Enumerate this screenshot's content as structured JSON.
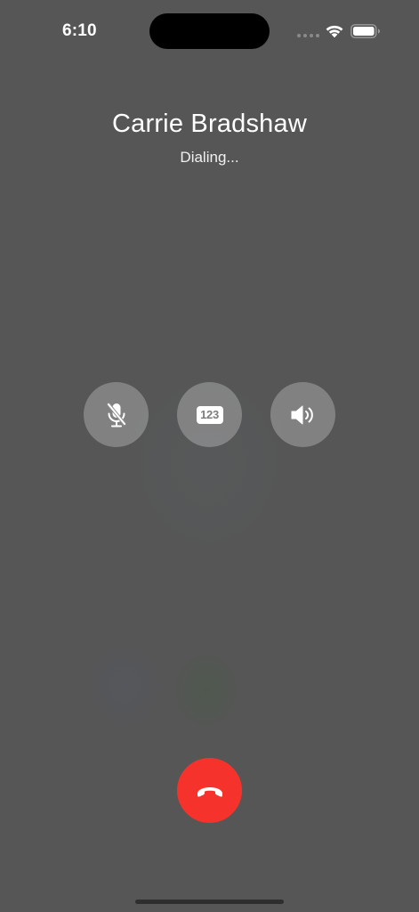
{
  "status_bar": {
    "time": "6:10",
    "icons": [
      "cellular-signal-icon",
      "wifi-icon",
      "battery-icon"
    ]
  },
  "call": {
    "caller_name": "Carrie Bradshaw",
    "status": "Dialing..."
  },
  "controls": {
    "mute": {
      "icon": "mic-slash-icon"
    },
    "keypad": {
      "icon": "keypad-icon",
      "text": "123"
    },
    "speaker": {
      "icon": "speaker-icon"
    },
    "end_call": {
      "icon": "phone-down-icon"
    }
  },
  "colors": {
    "background": "#565656",
    "control_button": "rgba(255,255,255,0.26)",
    "end_call": "#f5332c",
    "text": "#ffffff"
  }
}
